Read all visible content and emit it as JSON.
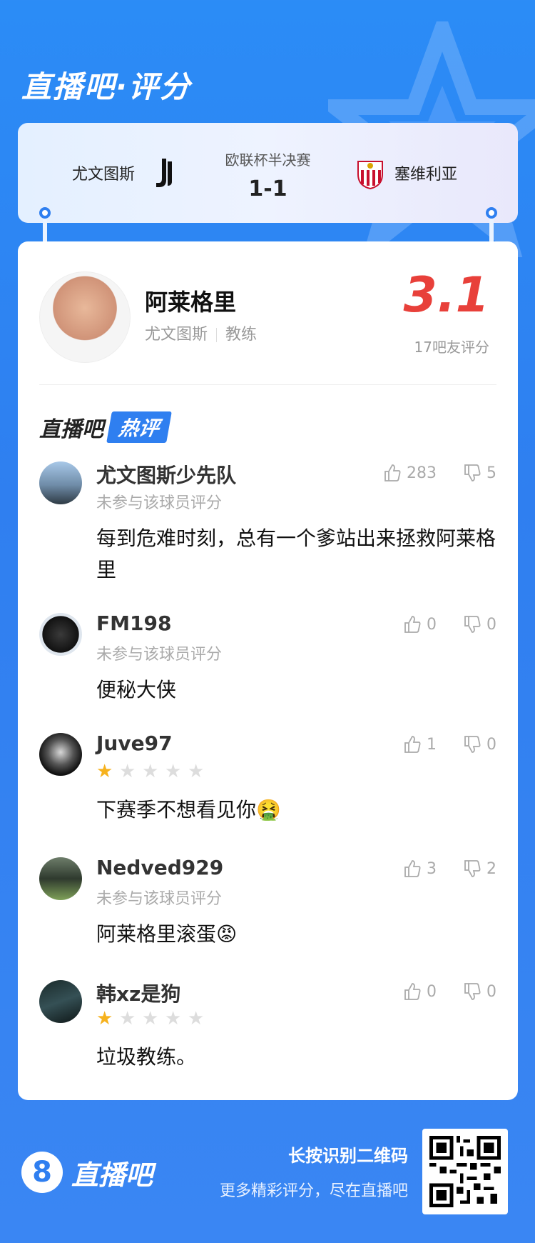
{
  "header": {
    "brand_title": "直播吧·评分"
  },
  "match": {
    "home_team": "尤文图斯",
    "stage": "欧联杯半决赛",
    "score": "1-1",
    "away_team": "塞维利亚"
  },
  "player": {
    "name": "阿莱格里",
    "team": "尤文图斯",
    "role": "教练",
    "rating": "3.1",
    "rating_count": "17吧友评分"
  },
  "hot_section": {
    "brand": "直播吧",
    "badge": "热评"
  },
  "comments": [
    {
      "user": "尤文图斯少先队",
      "sub": "未参与该球员评分",
      "stars": null,
      "text": "每到危难时刻，总有一个爹站出来拯救阿莱格里",
      "likes": "283",
      "dislikes": "5"
    },
    {
      "user": "FM198",
      "sub": "未参与该球员评分",
      "stars": null,
      "text": "便秘大侠",
      "likes": "0",
      "dislikes": "0"
    },
    {
      "user": "Juve97",
      "sub": "",
      "stars": 1,
      "text": "下赛季不想看见你🤮",
      "likes": "1",
      "dislikes": "0"
    },
    {
      "user": "Nedved929",
      "sub": "未参与该球员评分",
      "stars": null,
      "text": "阿莱格里滚蛋😡",
      "likes": "3",
      "dislikes": "2"
    },
    {
      "user": "韩xz是狗",
      "sub": "",
      "stars": 1,
      "text": "垃圾教练。",
      "likes": "0",
      "dislikes": "0"
    }
  ],
  "footer": {
    "logo_digit": "8",
    "logo_text": "直播吧",
    "cta_title": "长按识别二维码",
    "cta_sub": "更多精彩评分，尽在直播吧"
  },
  "colors": {
    "accent": "#2f7ff0",
    "rating": "#e8403a",
    "star_on": "#f6b21e"
  }
}
